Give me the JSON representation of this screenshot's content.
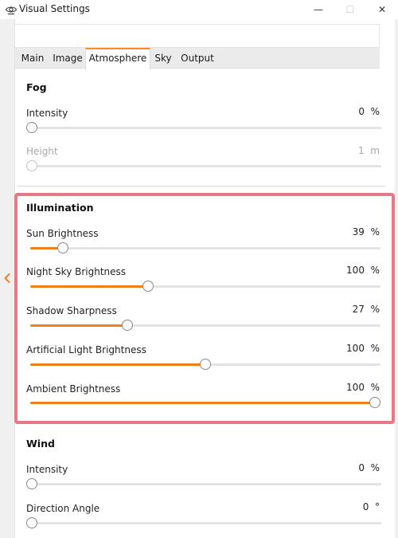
{
  "window": {
    "title": "Visual Settings",
    "minimize_glyph": "—",
    "maximize_glyph": "☐",
    "close_glyph": "✕"
  },
  "tabs": [
    {
      "label": "Main",
      "active": false
    },
    {
      "label": "Image",
      "active": false
    },
    {
      "label": "Atmosphere",
      "active": true
    },
    {
      "label": "Sky",
      "active": false
    },
    {
      "label": "Output",
      "active": false
    }
  ],
  "fog": {
    "title": "Fog",
    "intensity": {
      "label": "Intensity",
      "value": "0",
      "unit": "%",
      "level": 0
    },
    "height": {
      "label": "Height",
      "value": "1",
      "unit": "m",
      "level": 0,
      "disabled": true
    }
  },
  "illumination": {
    "title": "Illumination",
    "sun_brightness": {
      "label": "Sun Brightness",
      "value": "39",
      "unit": "%",
      "level": 0.08
    },
    "night_sky_brightness": {
      "label": "Night Sky Brightness",
      "value": "100",
      "unit": "%",
      "level": 0.33
    },
    "shadow_sharpness": {
      "label": "Shadow Sharpness",
      "value": "27",
      "unit": "%",
      "level": 0.27
    },
    "artificial_light_brightness": {
      "label": "Artificial Light Brightness",
      "value": "100",
      "unit": "%",
      "level": 0.5
    },
    "ambient_brightness": {
      "label": "Ambient Brightness",
      "value": "100",
      "unit": "%",
      "level": 1.0
    }
  },
  "wind": {
    "title": "Wind",
    "intensity": {
      "label": "Intensity",
      "value": "0",
      "unit": "%",
      "level": 0
    },
    "direction_angle": {
      "label": "Direction Angle",
      "value": "0",
      "unit": "°",
      "level": 0
    }
  },
  "colors": {
    "accent": "#f07f1a",
    "highlight_border": "#e57a87"
  },
  "icons": {
    "app": "eye-icon",
    "collapse": "chevron-left-icon"
  }
}
